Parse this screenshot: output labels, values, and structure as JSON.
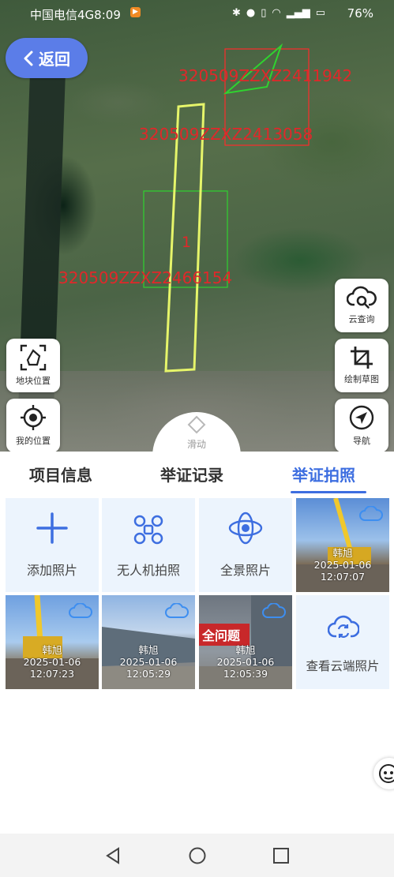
{
  "status_bar": {
    "carrier": "中国电信4G",
    "time": "8:09",
    "battery": "76%",
    "icons": [
      "bluetooth-icon",
      "location-icon",
      "vibrate-icon",
      "wifi-icon",
      "signal-icon",
      "battery-icon"
    ]
  },
  "map": {
    "back_label": "返回",
    "parcel_labels": [
      {
        "text": "320509ZZXZ2411942"
      },
      {
        "text": "320509ZZXZ2413058"
      },
      {
        "text": "1"
      },
      {
        "text": "320509ZZXZ2466154"
      }
    ],
    "left_buttons": [
      {
        "label": "地块位置",
        "icon": "parcel-location-icon"
      },
      {
        "label": "我的位置",
        "icon": "my-location-icon"
      }
    ],
    "right_buttons": [
      {
        "label": "云查询",
        "icon": "cloud-search-icon"
      },
      {
        "label": "绘制草图",
        "icon": "crop-icon"
      },
      {
        "label": "导航",
        "icon": "navigation-icon"
      }
    ],
    "slide_label": "滑动",
    "colors": {
      "parcel_outline": "#e6f56a",
      "label_red": "#e0282a",
      "box_red": "#ff2b2b",
      "box_green": "#2fd32f"
    }
  },
  "tabs": {
    "items": [
      {
        "label": "项目信息"
      },
      {
        "label": "举证记录"
      },
      {
        "label": "举证拍照"
      }
    ],
    "active_index": 2,
    "accent": "#3d6ee0"
  },
  "grid": {
    "actions": [
      {
        "label": "添加照片",
        "icon": "plus-icon"
      },
      {
        "label": "无人机拍照",
        "icon": "drone-icon"
      },
      {
        "label": "全景照片",
        "icon": "panorama-icon"
      }
    ],
    "photos": [
      {
        "user": "韩旭",
        "date": "2025-01-06",
        "time": "12:07:07"
      },
      {
        "user": "韩旭",
        "date": "2025-01-06",
        "time": "12:07:23"
      },
      {
        "user": "韩旭",
        "date": "2025-01-06",
        "time": "12:05:29"
      },
      {
        "user": "韩旭",
        "date": "2025-01-06",
        "time": "12:05:39",
        "sign_text": "全问题"
      }
    ],
    "cloud_button": {
      "label": "查看云端照片",
      "icon": "cloud-sync-icon"
    }
  }
}
